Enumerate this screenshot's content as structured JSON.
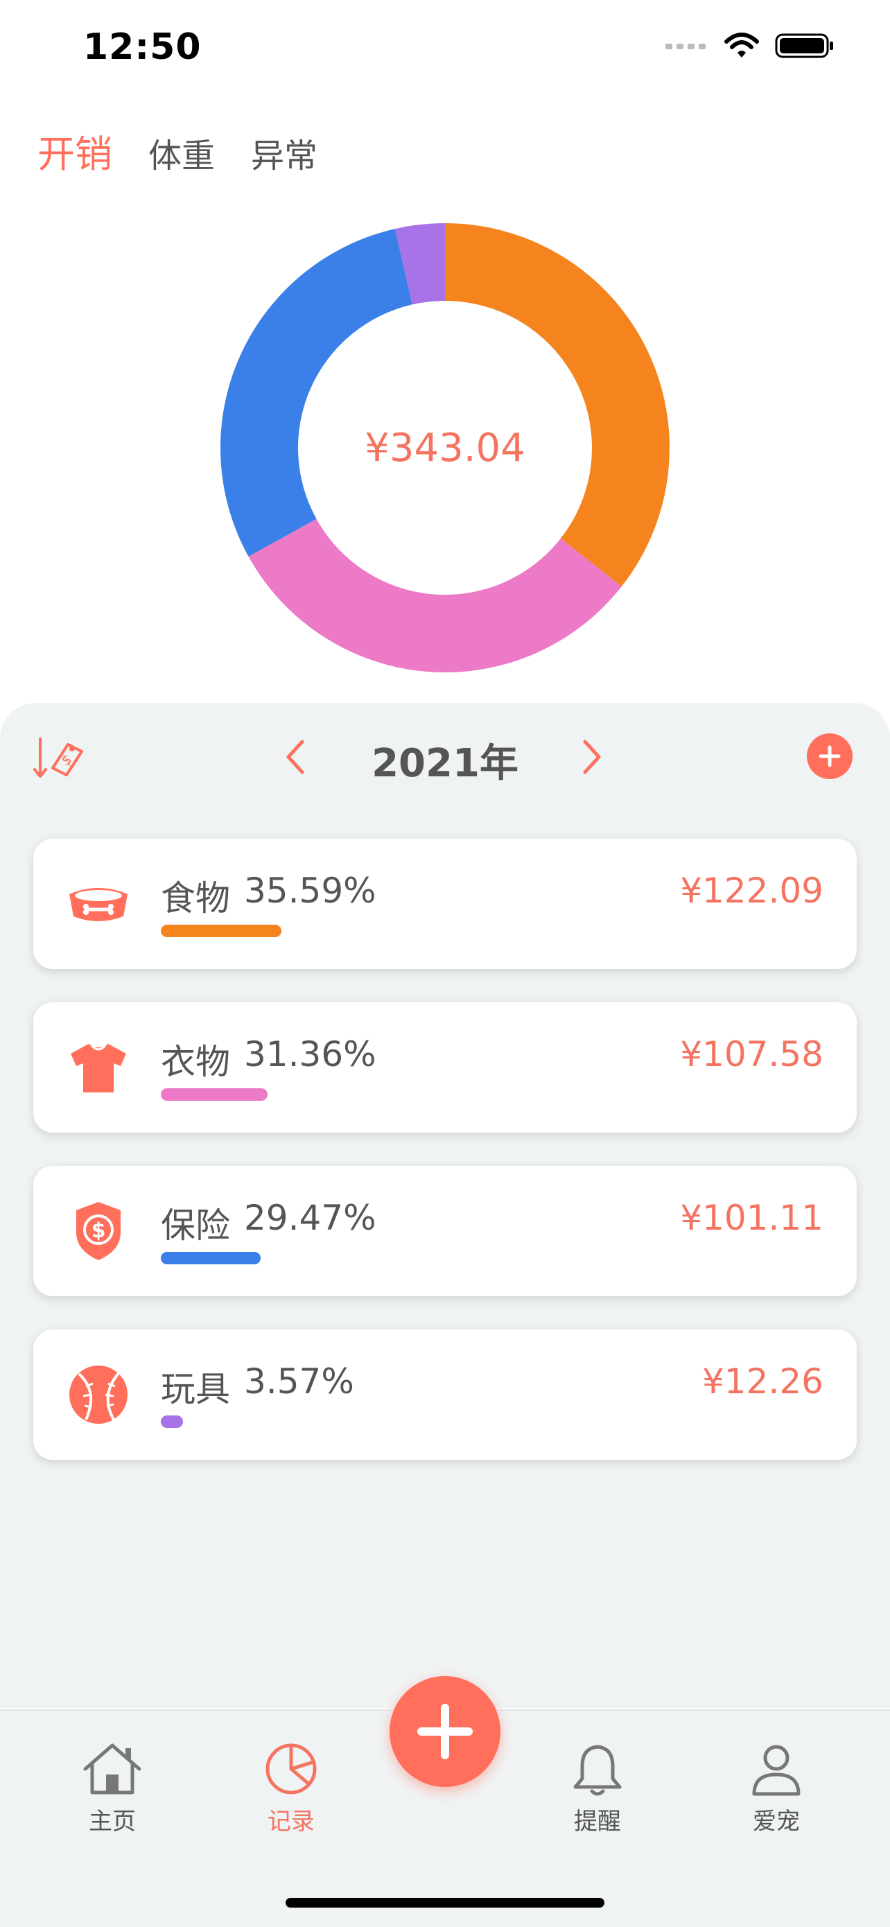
{
  "status_bar": {
    "time": "12:50"
  },
  "top_tabs": [
    {
      "label": "开销",
      "active": true
    },
    {
      "label": "体重",
      "active": false
    },
    {
      "label": "异常",
      "active": false
    }
  ],
  "summary": {
    "total": "¥343.04"
  },
  "chart_data": {
    "type": "pie",
    "categories": [
      "食物",
      "衣物",
      "保险",
      "玩具"
    ],
    "values": [
      35.59,
      31.36,
      29.47,
      3.57
    ],
    "colors": [
      "#F5841F",
      "#EC7AC7",
      "#3B80E8",
      "#A873E6"
    ],
    "amounts": [
      122.09,
      107.58,
      101.11,
      12.26
    ],
    "total": 343.04
  },
  "year_nav": {
    "year_label": "2021年"
  },
  "categories": [
    {
      "name": "食物",
      "percent": "35.59%",
      "amount": "¥122.09",
      "fraction": 0.3559,
      "color": "#F5841F",
      "icon": "food-bowl-icon"
    },
    {
      "name": "衣物",
      "percent": "31.36%",
      "amount": "¥107.58",
      "fraction": 0.3136,
      "color": "#EC7AC7",
      "icon": "tshirt-icon"
    },
    {
      "name": "保险",
      "percent": "29.47%",
      "amount": "¥101.11",
      "fraction": 0.2947,
      "color": "#3B80E8",
      "icon": "shield-dollar-icon"
    },
    {
      "name": "玩具",
      "percent": "3.57%",
      "amount": "¥12.26",
      "fraction": 0.0357,
      "color": "#A873E6",
      "icon": "ball-icon"
    }
  ],
  "tab_bar": {
    "items": [
      {
        "label": "主页",
        "icon": "home-icon",
        "active": false
      },
      {
        "label": "记录",
        "icon": "pie-chart-icon",
        "active": true
      },
      {
        "label": "提醒",
        "icon": "bell-icon",
        "active": false
      },
      {
        "label": "爱宠",
        "icon": "user-icon",
        "active": false
      }
    ]
  },
  "colors": {
    "accent": "#FF6F5B",
    "text": "#555555",
    "panel_bg": "#F0F3F4"
  }
}
